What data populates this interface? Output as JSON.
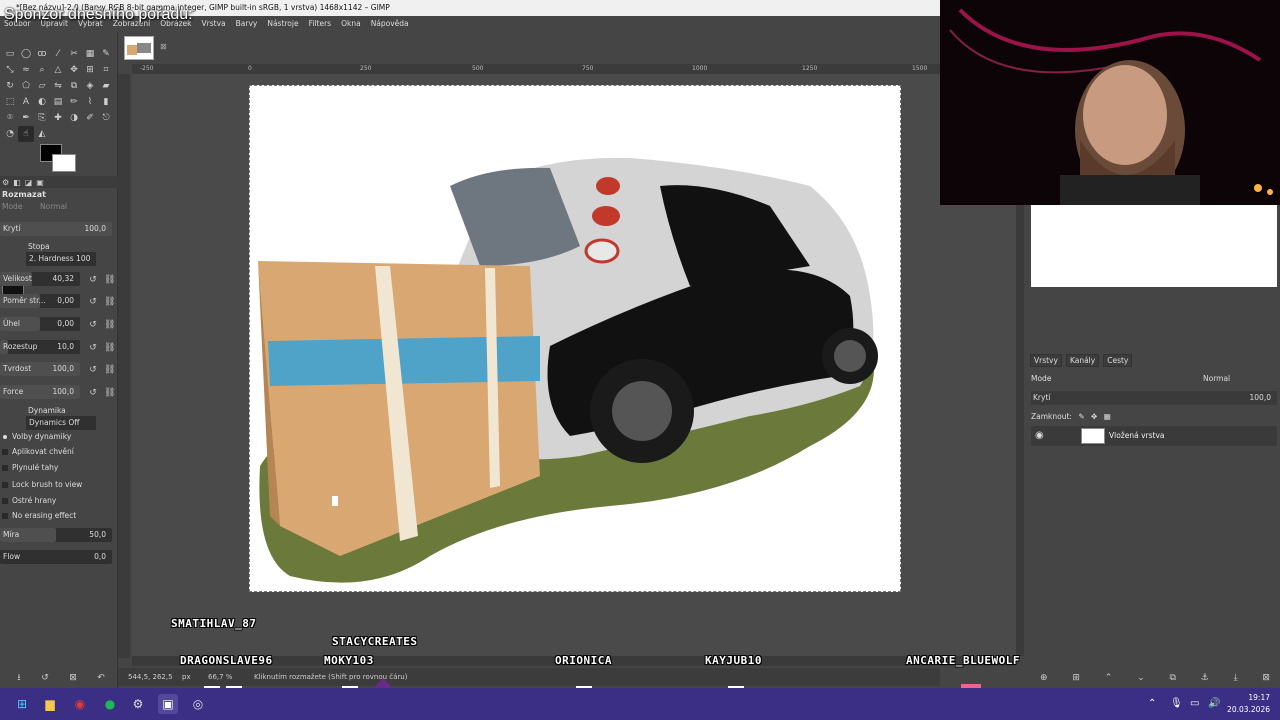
{
  "window": {
    "title": "*[Bez názvu]-2.0 (Barvy RGB 8-bit gamma integer, GIMP built-in sRGB, 1 vrstva) 1468x1142 – GIMP",
    "overlay_caption": "Sponzor dnešního pořadu:"
  },
  "menu": [
    "Soubor",
    "Upravit",
    "Vybrat",
    "Zobrazení",
    "Obrázek",
    "Vrstva",
    "Barvy",
    "Nástroje",
    "Filters",
    "Okna",
    "Nápověda"
  ],
  "ruler": {
    "ticks": [
      "-250",
      "0",
      "250",
      "500",
      "750",
      "1000",
      "1250",
      "1500"
    ]
  },
  "tool_options": {
    "title": "Rozmazat",
    "mode_label": "Mode",
    "mode_value": "Normal",
    "opacity_label": "Krytí",
    "opacity_value": "100,0",
    "brush_label": "Stopa",
    "brush_name": "2. Hardness 100",
    "size_label": "Velikost",
    "size_value": "40,32",
    "aspect_label": "Poměr str...",
    "aspect_value": "0,00",
    "angle_label": "Úhel",
    "angle_value": "0,00",
    "spacing_label": "Rozestup",
    "spacing_value": "10,0",
    "hardness_label": "Tvrdost",
    "hardness_value": "100,0",
    "force_label": "Force",
    "force_value": "100,0",
    "dynamics_label": "Dynamika",
    "dynamics_value": "Dynamics Off",
    "options": [
      "Volby dynamiky",
      "Aplikovat chvění",
      "Plynulé tahy",
      "Lock brush to view",
      "Ostré hrany",
      "No erasing effect"
    ],
    "rate_label": "Míra",
    "rate_value": "50,0",
    "flow_label": "Flow",
    "flow_value": "0,0"
  },
  "status": {
    "coords": "544,5, 262,5",
    "unit": "px",
    "zoom": "66,7 %",
    "message": "Kliknutím rozmažete (Shift pro rovnou čáru)"
  },
  "layers_panel": {
    "tabs": [
      "Vrstvy",
      "Kanály",
      "Cesty"
    ],
    "mode_label": "Mode",
    "mode_value": "Normal",
    "opacity_label": "Krytí",
    "opacity_value": "100,0",
    "lock_label": "Zamknout:",
    "layer_name": "Vložená vrstva"
  },
  "viewers": {
    "v1": "SMATIHLAV_87",
    "v2": "STACYCREATES",
    "v3": "DRAGONSLAVE96",
    "v4": "MOKY103",
    "v5": "ORIONICA",
    "v6": "KAYJUB10",
    "v7": "ANCARIE_BLUEWOLF"
  },
  "clock": {
    "time": "19:17",
    "date": "20.03.2026"
  },
  "colors": {
    "accent": "#3b2f85",
    "box_tape": "#4fa3c9",
    "box": "#d9a872",
    "grass": "#6b7a3a"
  }
}
